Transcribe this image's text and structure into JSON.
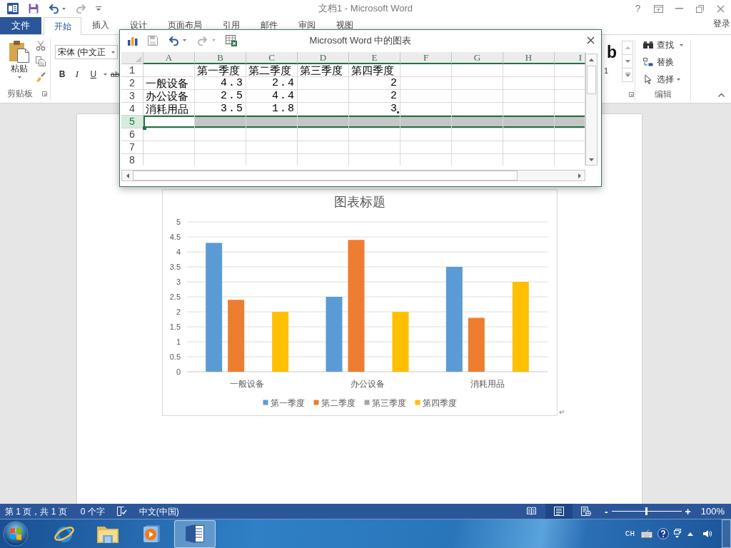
{
  "title_bar": {
    "title": "文档1 - Microsoft Word",
    "help": "?"
  },
  "ribbon": {
    "tabs": [
      {
        "label": "文件",
        "kind": "menu",
        "selected": false
      },
      {
        "label": "开始",
        "kind": "tab",
        "selected": true
      },
      {
        "label": "插入",
        "kind": "tab",
        "selected": false
      },
      {
        "label": "设计",
        "kind": "tab",
        "selected": false
      },
      {
        "label": "页面布局",
        "kind": "tab",
        "selected": false
      },
      {
        "label": "引用",
        "kind": "tab",
        "selected": false
      },
      {
        "label": "邮件",
        "kind": "tab",
        "selected": false
      },
      {
        "label": "审阅",
        "kind": "tab",
        "selected": false
      },
      {
        "label": "视图",
        "kind": "tab",
        "selected": false
      }
    ],
    "sign_in": "登录",
    "clipboard": {
      "paste": "粘贴",
      "group_label": "剪贴板"
    },
    "font": {
      "font_name": "宋体 (中文正",
      "bold": "B",
      "italic": "I",
      "underline": "U",
      "strikethrough": "ab"
    },
    "styles": {
      "preview": "b",
      "style_name": "1"
    },
    "editing": {
      "find": "查找",
      "replace": "替换",
      "select": "选择",
      "group_label": "编辑"
    }
  },
  "chart_window": {
    "title": "Microsoft Word 中的图表",
    "columns": [
      "A",
      "B",
      "C",
      "D",
      "E",
      "F",
      "G",
      "H",
      "I"
    ],
    "rows": [
      {
        "header": "1",
        "selected": false,
        "cells": [
          null,
          {
            "kind": "text",
            "text": "第一季度"
          },
          {
            "kind": "text",
            "text": "第二季度"
          },
          {
            "kind": "text",
            "text": "第三季度"
          },
          {
            "kind": "text",
            "text": "第四季度"
          }
        ]
      },
      {
        "header": "2",
        "selected": false,
        "cells": [
          {
            "kind": "text",
            "text": "一般设备"
          },
          {
            "kind": "number",
            "text": "4.3"
          },
          {
            "kind": "number",
            "text": "2.4"
          },
          null,
          {
            "kind": "number",
            "text": "2"
          }
        ]
      },
      {
        "header": "3",
        "selected": false,
        "cells": [
          {
            "kind": "text",
            "text": "办公设备"
          },
          {
            "kind": "number",
            "text": "2.5"
          },
          {
            "kind": "number",
            "text": "4.4"
          },
          null,
          {
            "kind": "number",
            "text": "2"
          }
        ]
      },
      {
        "header": "4",
        "selected": false,
        "cells": [
          {
            "kind": "text",
            "text": "消耗用品"
          },
          {
            "kind": "number",
            "text": "3.5"
          },
          {
            "kind": "number",
            "text": "1.8"
          },
          null,
          {
            "kind": "number",
            "text": "3"
          }
        ]
      },
      {
        "header": "5",
        "selected": true
      },
      {
        "header": "6",
        "selected": false
      },
      {
        "header": "7",
        "selected": false
      },
      {
        "header": "8",
        "selected": false
      }
    ]
  },
  "document": {
    "chart": {
      "chart_data": {
        "type": "bar",
        "title": "图表标题",
        "categories": [
          "一般设备",
          "办公设备",
          "消耗用品"
        ],
        "series": [
          {
            "name": "第一季度",
            "color": "#5b9bd5",
            "values": [
              4.3,
              2.5,
              3.5
            ]
          },
          {
            "name": "第二季度",
            "color": "#ed7d31",
            "values": [
              2.4,
              4.4,
              1.8
            ]
          },
          {
            "name": "第三季度",
            "color": "#a5a5a5",
            "values": [
              null,
              null,
              null
            ]
          },
          {
            "name": "第四季度",
            "color": "#ffc000",
            "values": [
              2,
              2,
              3
            ]
          }
        ],
        "ylim": [
          0,
          5
        ],
        "yticks": [
          0,
          0.5,
          1,
          1.5,
          2,
          2.5,
          3,
          3.5,
          4,
          4.5,
          5
        ],
        "grid": true,
        "legend": "bottom"
      }
    },
    "paragraph_mark": "↵"
  },
  "status_bar": {
    "page_info": "第 1 页，共 1 页",
    "word_count": "0 个字",
    "language": "中文(中国)",
    "views": [
      {
        "kind": "read",
        "selected": false
      },
      {
        "kind": "print",
        "selected": true
      },
      {
        "kind": "web",
        "selected": false
      }
    ],
    "zoom": {
      "minus": "-",
      "plus": "+",
      "level": 0.5,
      "reading": "100%"
    }
  },
  "taskbar": {
    "apps": [
      {
        "kind": "browser",
        "selected": false
      },
      {
        "kind": "folder",
        "selected": false
      },
      {
        "kind": "media",
        "selected": false
      },
      {
        "kind": "word",
        "selected": true
      }
    ],
    "input_language": "CH"
  }
}
